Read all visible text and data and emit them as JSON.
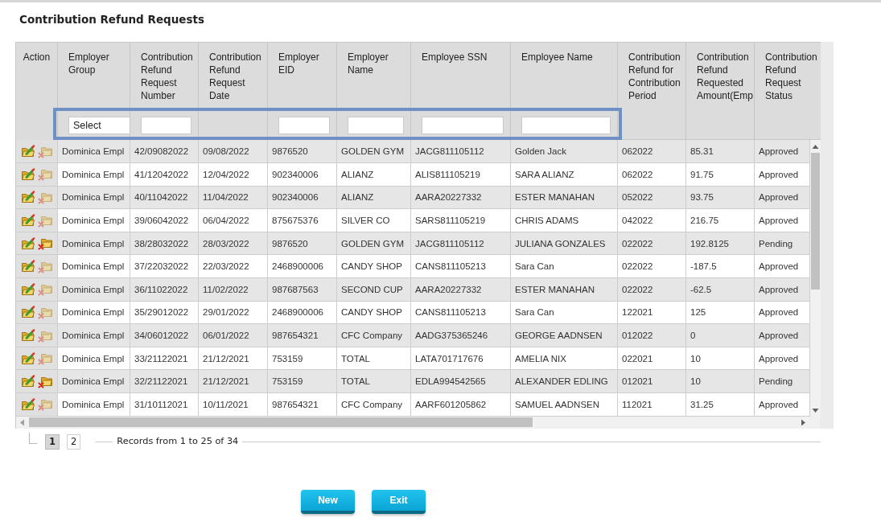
{
  "page": {
    "title": "Contribution Refund Requests"
  },
  "table": {
    "columns": [
      {
        "label": "Action"
      },
      {
        "label": "Employer Group",
        "filter": {
          "kind": "select",
          "value": "Select"
        }
      },
      {
        "label": "Contribution Refund Request Number",
        "filter": {
          "kind": "text"
        }
      },
      {
        "label": "Contribution Refund Request Date"
      },
      {
        "label": "Employer EID",
        "filter": {
          "kind": "text"
        }
      },
      {
        "label": "Employer Name",
        "filter": {
          "kind": "text"
        }
      },
      {
        "label": "Employee SSN",
        "filter": {
          "kind": "text"
        }
      },
      {
        "label": "Employee Name",
        "filter": {
          "kind": "text"
        }
      },
      {
        "label": "Contribution Refund for Contribution Period"
      },
      {
        "label": "Contribution Refund Requested Amount(Emp"
      },
      {
        "label": "Contribution Refund Request Status"
      }
    ],
    "rows": [
      {
        "cells": [
          "",
          "Dominica Empl",
          "42/09082022",
          "09/08/2022",
          "9876520",
          "GOLDEN GYM",
          "JACG811105112",
          "Golden Jack",
          "062022",
          "85.31",
          "Approved"
        ],
        "delete_enabled": false
      },
      {
        "cells": [
          "",
          "Dominica Empl",
          "41/12042022",
          "12/04/2022",
          "902340006",
          "ALIANZ",
          "ALIS811105219",
          "SARA ALIANZ",
          "062022",
          "91.75",
          "Approved"
        ],
        "delete_enabled": false
      },
      {
        "cells": [
          "",
          "Dominica Empl",
          "40/11042022",
          "11/04/2022",
          "902340006",
          "ALIANZ",
          "AARA20227332",
          "ESTER MANAHAN",
          "052022",
          "93.75",
          "Approved"
        ],
        "delete_enabled": false
      },
      {
        "cells": [
          "",
          "Dominica Empl",
          "39/06042022",
          "06/04/2022",
          "875675376",
          "SILVER CO",
          "SARS811105219",
          "CHRIS ADAMS",
          "042022",
          "216.75",
          "Approved"
        ],
        "delete_enabled": false
      },
      {
        "cells": [
          "",
          "Dominica Empl",
          "38/28032022",
          "28/03/2022",
          "9876520",
          "GOLDEN GYM",
          "JACG811105112",
          "JULIANA GONZALES",
          "022022",
          "192.8125",
          "Pending"
        ],
        "delete_enabled": true
      },
      {
        "cells": [
          "",
          "Dominica Empl",
          "37/22032022",
          "22/03/2022",
          "2468900006",
          "CANDY SHOP",
          "CANS811105213",
          "Sara Can",
          "022022",
          "-187.5",
          "Approved"
        ],
        "delete_enabled": false
      },
      {
        "cells": [
          "",
          "Dominica Empl",
          "36/11022022",
          "11/02/2022",
          "987687563",
          "SECOND CUP",
          "AARA20227332",
          "ESTER MANAHAN",
          "022022",
          "-62.5",
          "Approved"
        ],
        "delete_enabled": false
      },
      {
        "cells": [
          "",
          "Dominica Empl",
          "35/29012022",
          "29/01/2022",
          "2468900006",
          "CANDY SHOP",
          "CANS811105213",
          "Sara Can",
          "122021",
          "125",
          "Approved"
        ],
        "delete_enabled": false
      },
      {
        "cells": [
          "",
          "Dominica Empl",
          "34/06012022",
          "06/01/2022",
          "987654321",
          "CFC Company",
          "AADG375365246",
          "GEORGE AADNSEN",
          "012022",
          "0",
          "Approved"
        ],
        "delete_enabled": false
      },
      {
        "cells": [
          "",
          "Dominica Empl",
          "33/21122021",
          "21/12/2021",
          "753159",
          "TOTAL",
          "LATA701717676",
          "AMELIA NIX",
          "022021",
          "10",
          "Approved"
        ],
        "delete_enabled": false
      },
      {
        "cells": [
          "",
          "Dominica Empl",
          "32/21122021",
          "21/12/2021",
          "753159",
          "TOTAL",
          "EDLA994542565",
          "ALEXANDER EDLING",
          "012021",
          "10",
          "Pending"
        ],
        "delete_enabled": true
      },
      {
        "cells": [
          "",
          "Dominica Empl",
          "31/10112021",
          "10/11/2021",
          "987654321",
          "CFC Company",
          "AARF601205862",
          "SAMUEL AADNSEN",
          "112021",
          "31.25",
          "Approved"
        ],
        "delete_enabled": false
      }
    ]
  },
  "pager": {
    "pages": [
      {
        "label": "1",
        "selected": true
      },
      {
        "label": "2",
        "selected": false
      }
    ],
    "summary": "Records from 1 to 25 of 34"
  },
  "buttons": [
    {
      "label": "New"
    },
    {
      "label": "Exit"
    }
  ]
}
